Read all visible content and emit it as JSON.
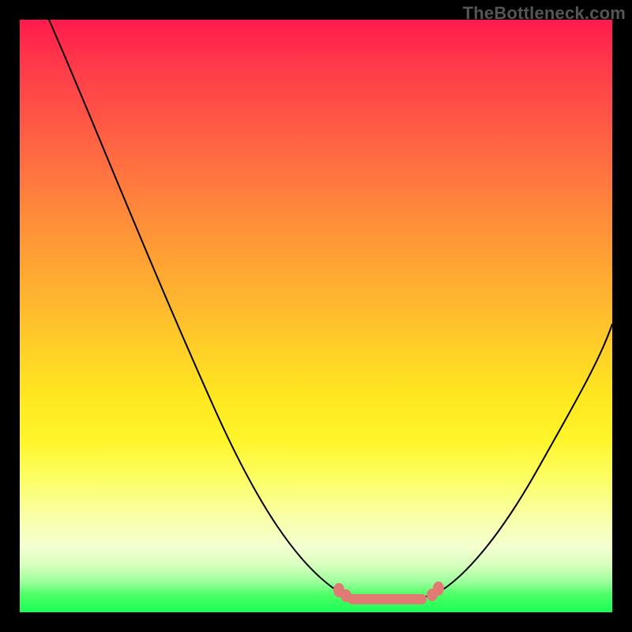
{
  "watermark": "TheBottleneck.com",
  "colors": {
    "frame": "#000000",
    "gradient_stops": [
      {
        "pos": 0.0,
        "hex": "#ff1a4d"
      },
      {
        "pos": 0.18,
        "hex": "#ff5a45"
      },
      {
        "pos": 0.38,
        "hex": "#ff9a36"
      },
      {
        "pos": 0.57,
        "hex": "#ffd426"
      },
      {
        "pos": 0.71,
        "hex": "#fff52a"
      },
      {
        "pos": 0.84,
        "hex": "#f9ffa8"
      },
      {
        "pos": 0.95,
        "hex": "#9aff9a"
      },
      {
        "pos": 1.0,
        "hex": "#1aff55"
      }
    ],
    "curve_stroke": "#000000",
    "marker_fill": "#e07a75"
  },
  "chart_data": {
    "type": "line",
    "title": "",
    "xlabel": "",
    "ylabel": "",
    "xlim": [
      0,
      100
    ],
    "ylim": [
      0,
      100
    ],
    "grid": false,
    "series": [
      {
        "name": "curve-left",
        "x": [
          5,
          10,
          15,
          20,
          25,
          30,
          35,
          40,
          45,
          50,
          55
        ],
        "y": [
          100,
          88,
          76,
          64,
          52,
          41,
          30,
          21,
          13,
          7,
          3
        ]
      },
      {
        "name": "curve-right",
        "x": [
          70,
          75,
          80,
          85,
          90,
          95,
          100
        ],
        "y": [
          3,
          8,
          15,
          23,
          32,
          41,
          49
        ]
      },
      {
        "name": "minimum-band",
        "x": [
          55,
          57,
          59,
          61,
          63,
          65,
          67,
          69,
          70
        ],
        "y": [
          3,
          2.5,
          2.3,
          2.2,
          2.2,
          2.3,
          2.5,
          2.8,
          3
        ]
      }
    ],
    "annotations": [
      {
        "type": "marker-band",
        "color": "#e07a75",
        "x_range": [
          55,
          70
        ],
        "y": 3
      }
    ]
  }
}
